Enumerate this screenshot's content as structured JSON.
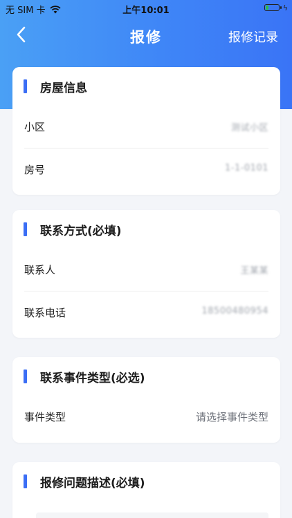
{
  "status_bar": {
    "carrier": "无 SIM 卡",
    "time": "上午10:01"
  },
  "nav": {
    "title": "报修",
    "record_label": "报修记录"
  },
  "sections": {
    "house": {
      "title": "房屋信息",
      "rows": [
        {
          "label": "小区",
          "value": "测试小区"
        },
        {
          "label": "房号",
          "value": "1-1-0101"
        }
      ]
    },
    "contact": {
      "title": "联系方式(必填)",
      "rows": [
        {
          "label": "联系人",
          "value": "王某某"
        },
        {
          "label": "联系电话",
          "value": "18500480954"
        }
      ]
    },
    "event": {
      "title": "联系事件类型(必选)",
      "rows": [
        {
          "label": "事件类型",
          "placeholder": "请选择事件类型"
        }
      ]
    },
    "description": {
      "title": "报修问题描述(必填)"
    }
  },
  "colors": {
    "accent": "#3b6ef5",
    "header_gradient_start": "#4aa0f5",
    "header_gradient_end": "#3a74f6",
    "battery_level": "#2fbd4a"
  },
  "battery_level_fraction": 0.25
}
